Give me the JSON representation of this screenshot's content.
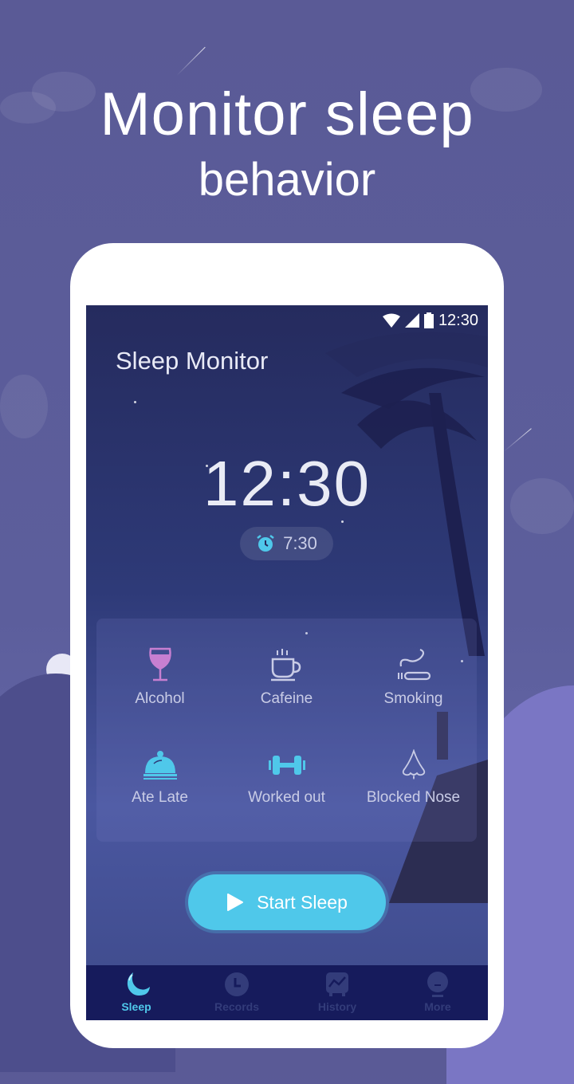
{
  "promo": {
    "headline_line1": "Monitor sleep",
    "headline_line2": "behavior"
  },
  "status_bar": {
    "time": "12:30",
    "icons": [
      "wifi-icon",
      "cell-signal-icon",
      "battery-icon"
    ]
  },
  "app": {
    "title": "Sleep Monitor",
    "clock_time": "12:30",
    "alarm_time": "7:30"
  },
  "factors": [
    {
      "label": "Alcohol",
      "icon": "wine-glass-icon",
      "color": "#c77fd1"
    },
    {
      "label": "Cafeine",
      "icon": "coffee-cup-icon",
      "color": "#c9cce6"
    },
    {
      "label": "Smoking",
      "icon": "cigarette-icon",
      "color": "#c9cce6"
    },
    {
      "label": "Ate Late",
      "icon": "food-cloche-icon",
      "color": "#4fc8ea"
    },
    {
      "label": "Worked out",
      "icon": "dumbbell-icon",
      "color": "#4fc8ea"
    },
    {
      "label": "Blocked Nose",
      "icon": "nose-icon",
      "color": "#c9cce6"
    }
  ],
  "start_button": {
    "label": "Start Sleep"
  },
  "tabs": [
    {
      "label": "Sleep",
      "icon": "moon-icon",
      "active": true
    },
    {
      "label": "Records",
      "icon": "clock-icon",
      "active": false
    },
    {
      "label": "History",
      "icon": "chart-icon",
      "active": false
    },
    {
      "label": "More",
      "icon": "more-face-icon",
      "active": false
    }
  ],
  "colors": {
    "accent": "#4fc8ea",
    "tabbar_bg": "#161b5c",
    "inactive_tab": "#333c7a"
  }
}
